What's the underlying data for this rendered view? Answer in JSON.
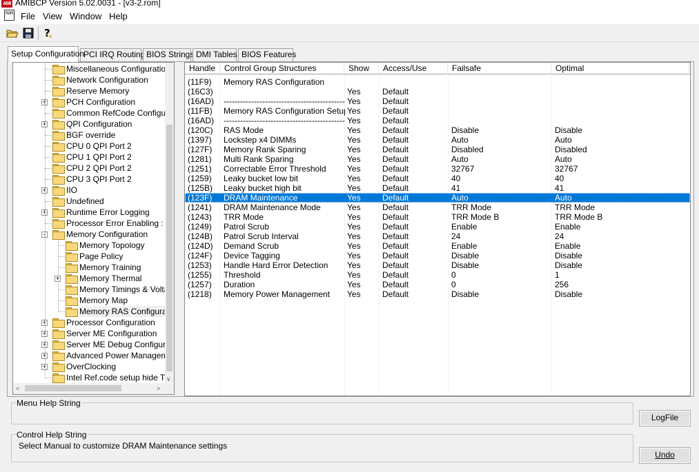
{
  "window": {
    "title": "AMIBCP Version 5.02.0031 - [v3-2.rom]",
    "app_icon_text": "AMI",
    "doc_icon_text": "ROM"
  },
  "menu": [
    "File",
    "View",
    "Window",
    "Help"
  ],
  "toolbar": {
    "icons": [
      "open-folder-icon",
      "save-icon",
      "help-icon"
    ]
  },
  "tabs": [
    "Setup Configuration",
    "PCI IRQ Routing",
    "BIOS Strings",
    "DMI Tables",
    "BIOS Features"
  ],
  "tree": {
    "nodes": [
      {
        "label": "Miscellaneous Configuration",
        "level": 0,
        "expander": ""
      },
      {
        "label": "Network Configuration",
        "level": 0,
        "expander": ""
      },
      {
        "label": "Reserve Memory",
        "level": 0,
        "expander": ""
      },
      {
        "label": "PCH Configuration",
        "level": 0,
        "expander": "+"
      },
      {
        "label": "Common RefCode Configuration",
        "level": 0,
        "expander": ""
      },
      {
        "label": "QPI Configuration",
        "level": 0,
        "expander": "+"
      },
      {
        "label": "BGF override",
        "level": 0,
        "expander": ""
      },
      {
        "label": "CPU 0 QPI Port 2",
        "level": 0,
        "expander": ""
      },
      {
        "label": "CPU 1 QPI Port 2",
        "level": 0,
        "expander": ""
      },
      {
        "label": "CPU 2 QPI Port 2",
        "level": 0,
        "expander": ""
      },
      {
        "label": "CPU 3 QPI Port 2",
        "level": 0,
        "expander": ""
      },
      {
        "label": "IIO",
        "level": 0,
        "expander": "+"
      },
      {
        "label": "Undefined",
        "level": 0,
        "expander": ""
      },
      {
        "label": "Runtime Error Logging",
        "level": 0,
        "expander": "+"
      },
      {
        "label": "Processor Error Enabling :",
        "level": 0,
        "expander": ""
      },
      {
        "label": "Memory Configuration",
        "level": 0,
        "expander": "-"
      },
      {
        "label": "Memory Topology",
        "level": 1,
        "expander": ""
      },
      {
        "label": "Page Policy",
        "level": 1,
        "expander": ""
      },
      {
        "label": "Memory Training",
        "level": 1,
        "expander": ""
      },
      {
        "label": "Memory Thermal",
        "level": 1,
        "expander": "+"
      },
      {
        "label": "Memory Timings & Voltage",
        "level": 1,
        "expander": ""
      },
      {
        "label": "Memory Map",
        "level": 1,
        "expander": ""
      },
      {
        "label": "Memory RAS Configuration",
        "level": 1,
        "expander": "",
        "selected": true
      },
      {
        "label": "Processor Configuration",
        "level": 0,
        "expander": "+"
      },
      {
        "label": "Server ME Configuration",
        "level": 0,
        "expander": "+"
      },
      {
        "label": "Server ME Debug Configuration",
        "level": 0,
        "expander": "+"
      },
      {
        "label": "Advanced Power Management",
        "level": 0,
        "expander": "+"
      },
      {
        "label": "OverClocking",
        "level": 0,
        "expander": "+"
      },
      {
        "label": "Intel Ref.code setup hide Title",
        "level": 0,
        "expander": ""
      }
    ]
  },
  "grid": {
    "columns": [
      "Handle",
      "Control Group Structures",
      "Show",
      "Access/Use",
      "Failsafe",
      "Optimal"
    ],
    "rows": [
      [
        "(11F9)",
        "Memory RAS Configuration",
        "",
        "",
        "",
        ""
      ],
      [
        "(16C3)",
        "",
        "Yes",
        "Default",
        "",
        ""
      ],
      [
        "(16AD)",
        "----------------------------------------------------",
        "Yes",
        "Default",
        "",
        ""
      ],
      [
        "(11FB)",
        "Memory RAS Configuration Setup",
        "Yes",
        "Default",
        "",
        ""
      ],
      [
        "(16AD)",
        "----------------------------------------------------",
        "Yes",
        "Default",
        "",
        ""
      ],
      [
        "(120C)",
        "RAS Mode",
        "Yes",
        "Default",
        "Disable",
        "Disable"
      ],
      [
        "(1397)",
        "Lockstep x4 DIMMs",
        "Yes",
        "Default",
        "Auto",
        "Auto"
      ],
      [
        "(127F)",
        "Memory Rank Sparing",
        "Yes",
        "Default",
        "Disabled",
        "Disabled"
      ],
      [
        "(1281)",
        "Multi Rank Sparing",
        "Yes",
        "Default",
        "Auto",
        "Auto"
      ],
      [
        "(1251)",
        "Correctable Error Threshold",
        "Yes",
        "Default",
        "32767",
        "32767"
      ],
      [
        "(1259)",
        "Leaky bucket low bit",
        "Yes",
        "Default",
        "40",
        "40"
      ],
      [
        "(125B)",
        "Leaky bucket high bit",
        "Yes",
        "Default",
        "41",
        "41"
      ],
      [
        "(123F)",
        "DRAM Maintenance",
        "Yes",
        "Default",
        "Auto",
        "Auto"
      ],
      [
        "(1241)",
        "DRAM Maintenance Mode",
        "Yes",
        "Default",
        "TRR Mode",
        "TRR Mode"
      ],
      [
        "(1243)",
        "TRR Mode",
        "Yes",
        "Default",
        "TRR Mode B",
        "TRR Mode B"
      ],
      [
        "(1249)",
        "Patrol Scrub",
        "Yes",
        "Default",
        "Enable",
        "Enable"
      ],
      [
        "(124B)",
        "Patrol Scrub Interval",
        "Yes",
        "Default",
        "24",
        "24"
      ],
      [
        "(124D)",
        "Demand Scrub",
        "Yes",
        "Default",
        "Enable",
        "Enable"
      ],
      [
        "(124F)",
        "Device Tagging",
        "Yes",
        "Default",
        "Disable",
        "Disable"
      ],
      [
        "(1253)",
        "Handle Hard Error Detection",
        "Yes",
        "Default",
        "Disable",
        "Disable"
      ],
      [
        "(1255)",
        "Threshold",
        "Yes",
        "Default",
        "0",
        "1"
      ],
      [
        "(1257)",
        "Duration",
        "Yes",
        "Default",
        "0",
        "256"
      ],
      [
        "(1218)",
        "Memory Power Management",
        "Yes",
        "Default",
        "Disable",
        "Disable"
      ]
    ],
    "selected_row": 12
  },
  "menu_help": {
    "label": "Menu Help String",
    "text": ""
  },
  "control_help": {
    "label": "Control Help String",
    "text": "Select Manual to customize DRAM Maintenance settings"
  },
  "buttons": {
    "logfile": "LogFile",
    "undo": "Undo"
  },
  "colors": {
    "selection": "#0078d7",
    "app_icon": "#c0141c",
    "folder": "#f7d87a"
  }
}
